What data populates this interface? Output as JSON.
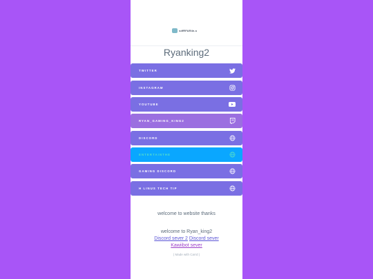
{
  "header": {
    "logo_text": "sdfRFAR4n-s"
  },
  "profile": {
    "username": "Ryanking2"
  },
  "links": [
    {
      "label": "TWITTER",
      "icon": "twitter-icon"
    },
    {
      "label": "INSTAGRAM",
      "icon": "instagram-icon"
    },
    {
      "label": "YOUTUBE",
      "icon": "youtube-icon"
    },
    {
      "label": "RYAN_GAMING_KING2",
      "icon": "twitch-icon"
    },
    {
      "label": "DISCORD",
      "icon": "globe-icon"
    },
    {
      "label": "ENTERTAINTHE",
      "icon": "globe-icon"
    },
    {
      "label": "GAMING DISCORD",
      "icon": "globe-icon"
    },
    {
      "label": "H LINUS TECH TIP",
      "icon": "globe-icon"
    }
  ],
  "footer": {
    "welcome": "welcome to website thanks",
    "welcome_user": "welcome to Ryan_king2",
    "link1": "Discord sever 2",
    "link2": "Discord sever",
    "link3": "Kawiibot sever",
    "made_with": "( Made with Carrd )"
  },
  "colors": {
    "page_background": "#a855f7",
    "link_button": "#7a6fe3",
    "link_button_twitch": "#9b6fe0",
    "link_button_highlight": "#0aa7ff"
  }
}
